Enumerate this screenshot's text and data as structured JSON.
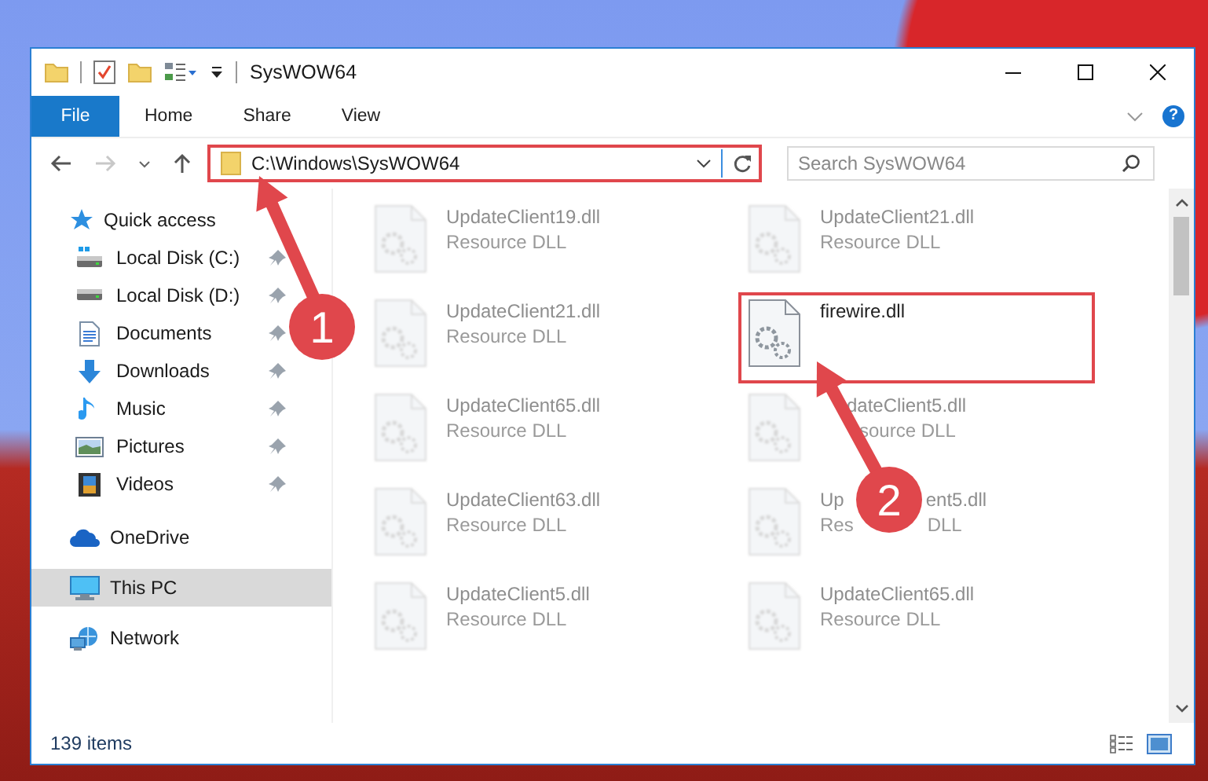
{
  "window": {
    "title": "SysWOW64"
  },
  "ribbon": {
    "tabs": [
      {
        "label": "File",
        "kind": "file"
      },
      {
        "label": "Home",
        "kind": "tab"
      },
      {
        "label": "Share",
        "kind": "tab"
      },
      {
        "label": "View",
        "kind": "tab"
      }
    ],
    "help": "?"
  },
  "navigation": {
    "forward_disabled": true
  },
  "address_bar": {
    "path": "C:\\Windows\\SysWOW64",
    "highlighted": true
  },
  "search": {
    "placeholder": "Search SysWOW64"
  },
  "sidebar": {
    "items": [
      {
        "label": "Quick access",
        "kind": "star",
        "selected": false,
        "children": [
          {
            "label": "Local Disk (C:)",
            "kind": "drive-c",
            "pinned": true,
            "selected": false
          },
          {
            "label": "Local Disk (D:)",
            "kind": "drive",
            "pinned": true,
            "selected": false
          },
          {
            "label": "Documents",
            "kind": "documents",
            "pinned": true,
            "selected": false
          },
          {
            "label": "Downloads",
            "kind": "downloads",
            "pinned": true,
            "selected": false
          },
          {
            "label": "Music",
            "kind": "music",
            "pinned": true,
            "selected": false
          },
          {
            "label": "Pictures",
            "kind": "pictures",
            "pinned": true,
            "selected": false
          },
          {
            "label": "Videos",
            "kind": "videos",
            "pinned": true,
            "selected": false
          }
        ]
      },
      {
        "label": "OneDrive",
        "kind": "cloud",
        "selected": false
      },
      {
        "label": "This PC",
        "kind": "pc",
        "selected": true
      },
      {
        "label": "Network",
        "kind": "network",
        "selected": false
      }
    ]
  },
  "files": [
    {
      "name": "UpdateClient19.dll",
      "type": "Resource DLL",
      "blurred": true,
      "highlighted": false
    },
    {
      "name": "UpdateClient21.dll",
      "type": "Resource DLL",
      "blurred": true,
      "highlighted": false
    },
    {
      "name": "UpdateClient21.dll",
      "type": "Resource DLL",
      "blurred": true,
      "highlighted": false
    },
    {
      "name": "firewire.dll",
      "blurred": false,
      "highlighted": true
    },
    {
      "name": "UpdateClient65.dll",
      "type": "Resource DLL",
      "blurred": true,
      "highlighted": false
    },
    {
      "name_parts": [
        "dateClient5.dll"
      ],
      "type_parts": [
        "source DLL"
      ],
      "blurred": true,
      "highlighted": false
    },
    {
      "name": "UpdateClient63.dll",
      "type": "Resource DLL",
      "blurred": true,
      "highlighted": false
    },
    {
      "name_parts": [
        "Up",
        "ent5.dll"
      ],
      "type_parts": [
        "Res",
        "DLL"
      ],
      "blurred": true,
      "highlighted": false
    },
    {
      "name": "UpdateClient5.dll",
      "type": "Resource DLL",
      "blurred": true,
      "highlighted": false
    },
    {
      "name": "UpdateClient65.dll",
      "type": "Resource DLL",
      "blurred": true,
      "highlighted": false
    }
  ],
  "status_bar": {
    "item_count": "139 items"
  },
  "annotations": [
    {
      "number": "1"
    },
    {
      "number": "2"
    }
  ]
}
